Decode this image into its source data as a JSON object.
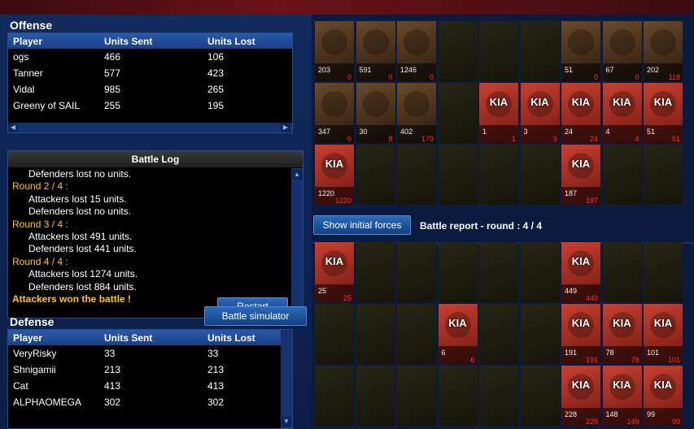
{
  "offense": {
    "title": "Offense",
    "headers": [
      "Player",
      "Units Sent",
      "Units Lost"
    ],
    "rows": [
      {
        "player": "ogs",
        "sent": "466",
        "lost": "106"
      },
      {
        "player": "Tanner",
        "sent": "577",
        "lost": "423"
      },
      {
        "player": "Vidal",
        "sent": "985",
        "lost": "265"
      },
      {
        "player": "Greeny of SAIL",
        "sent": "255",
        "lost": "195"
      }
    ]
  },
  "battle_log": {
    "title": "Battle Log",
    "lines": [
      {
        "type": "ind",
        "text": "Defenders lost no units."
      },
      {
        "type": "round",
        "text": "Round 2 / 4 :"
      },
      {
        "type": "ind",
        "text": "Attackers lost 15 units."
      },
      {
        "type": "ind",
        "text": "Defenders lost no units."
      },
      {
        "type": "round",
        "text": "Round 3 / 4 :"
      },
      {
        "type": "ind",
        "text": "Attackers lost 491 units."
      },
      {
        "type": "ind",
        "text": "Defenders lost 441 units."
      },
      {
        "type": "round",
        "text": "Round 4 / 4 :"
      },
      {
        "type": "ind",
        "text": "Attackers lost 1274 units."
      },
      {
        "type": "ind",
        "text": "Defenders lost 884 units."
      },
      {
        "type": "won",
        "text": "Attackers won the battle !"
      }
    ],
    "restart_label": "Restart"
  },
  "simulator_label": "Battle simulator",
  "defense": {
    "title": "Defense",
    "headers": [
      "Player",
      "Units Sent",
      "Units Lost"
    ],
    "rows": [
      {
        "player": "VeryRisky",
        "sent": "33",
        "lost": "33"
      },
      {
        "player": "Shnigamii",
        "sent": "213",
        "lost": "213"
      },
      {
        "player": "Cat",
        "sent": "413",
        "lost": "413"
      },
      {
        "player": "ALPHAOMEGA",
        "sent": "302",
        "lost": "302"
      }
    ]
  },
  "report": {
    "show_initial_label": "Show initial forces",
    "title": "Battle report - round : 4 / 4",
    "kia_label": "KIA"
  },
  "attack_grid": [
    {
      "state": "unit",
      "sent": "203",
      "lost": "0"
    },
    {
      "state": "unit",
      "sent": "591",
      "lost": "0"
    },
    {
      "state": "unit",
      "sent": "1246",
      "lost": "0"
    },
    {
      "state": "empty"
    },
    {
      "state": "empty"
    },
    {
      "state": "empty"
    },
    {
      "state": "unit",
      "sent": "51",
      "lost": "0"
    },
    {
      "state": "unit",
      "sent": "67",
      "lost": "0"
    },
    {
      "state": "unit",
      "sent": "202",
      "lost": "118"
    },
    {
      "state": "unit",
      "sent": "347",
      "lost": "0"
    },
    {
      "state": "unit",
      "sent": "30",
      "lost": "8"
    },
    {
      "state": "unit",
      "sent": "402",
      "lost": "179"
    },
    {
      "state": "empty"
    },
    {
      "state": "kia",
      "sent": "1",
      "lost": "1"
    },
    {
      "state": "kia",
      "sent": "3",
      "lost": "3"
    },
    {
      "state": "kia",
      "sent": "24",
      "lost": "24"
    },
    {
      "state": "kia",
      "sent": "4",
      "lost": "4"
    },
    {
      "state": "kia",
      "sent": "51",
      "lost": "51"
    },
    {
      "state": "kia",
      "sent": "1220",
      "lost": "1220"
    },
    {
      "state": "empty"
    },
    {
      "state": "empty"
    },
    {
      "state": "empty"
    },
    {
      "state": "empty"
    },
    {
      "state": "empty"
    },
    {
      "state": "kia",
      "sent": "187",
      "lost": "187"
    },
    {
      "state": "empty"
    },
    {
      "state": "empty"
    }
  ],
  "defense_grid": [
    {
      "state": "kia",
      "sent": "25",
      "lost": "25"
    },
    {
      "state": "empty"
    },
    {
      "state": "empty"
    },
    {
      "state": "empty"
    },
    {
      "state": "empty"
    },
    {
      "state": "empty"
    },
    {
      "state": "kia",
      "sent": "449",
      "lost": "449"
    },
    {
      "state": "empty"
    },
    {
      "state": "empty"
    },
    {
      "state": "empty"
    },
    {
      "state": "empty"
    },
    {
      "state": "empty"
    },
    {
      "state": "kia",
      "sent": "6",
      "lost": "6"
    },
    {
      "state": "empty"
    },
    {
      "state": "empty"
    },
    {
      "state": "kia",
      "sent": "191",
      "lost": "191"
    },
    {
      "state": "kia",
      "sent": "78",
      "lost": "78"
    },
    {
      "state": "kia",
      "sent": "101",
      "lost": "101"
    },
    {
      "state": "empty"
    },
    {
      "state": "empty"
    },
    {
      "state": "empty"
    },
    {
      "state": "empty"
    },
    {
      "state": "empty"
    },
    {
      "state": "empty"
    },
    {
      "state": "kia",
      "sent": "228",
      "lost": "228"
    },
    {
      "state": "kia",
      "sent": "148",
      "lost": "148"
    },
    {
      "state": "kia",
      "sent": "99",
      "lost": "99"
    }
  ]
}
